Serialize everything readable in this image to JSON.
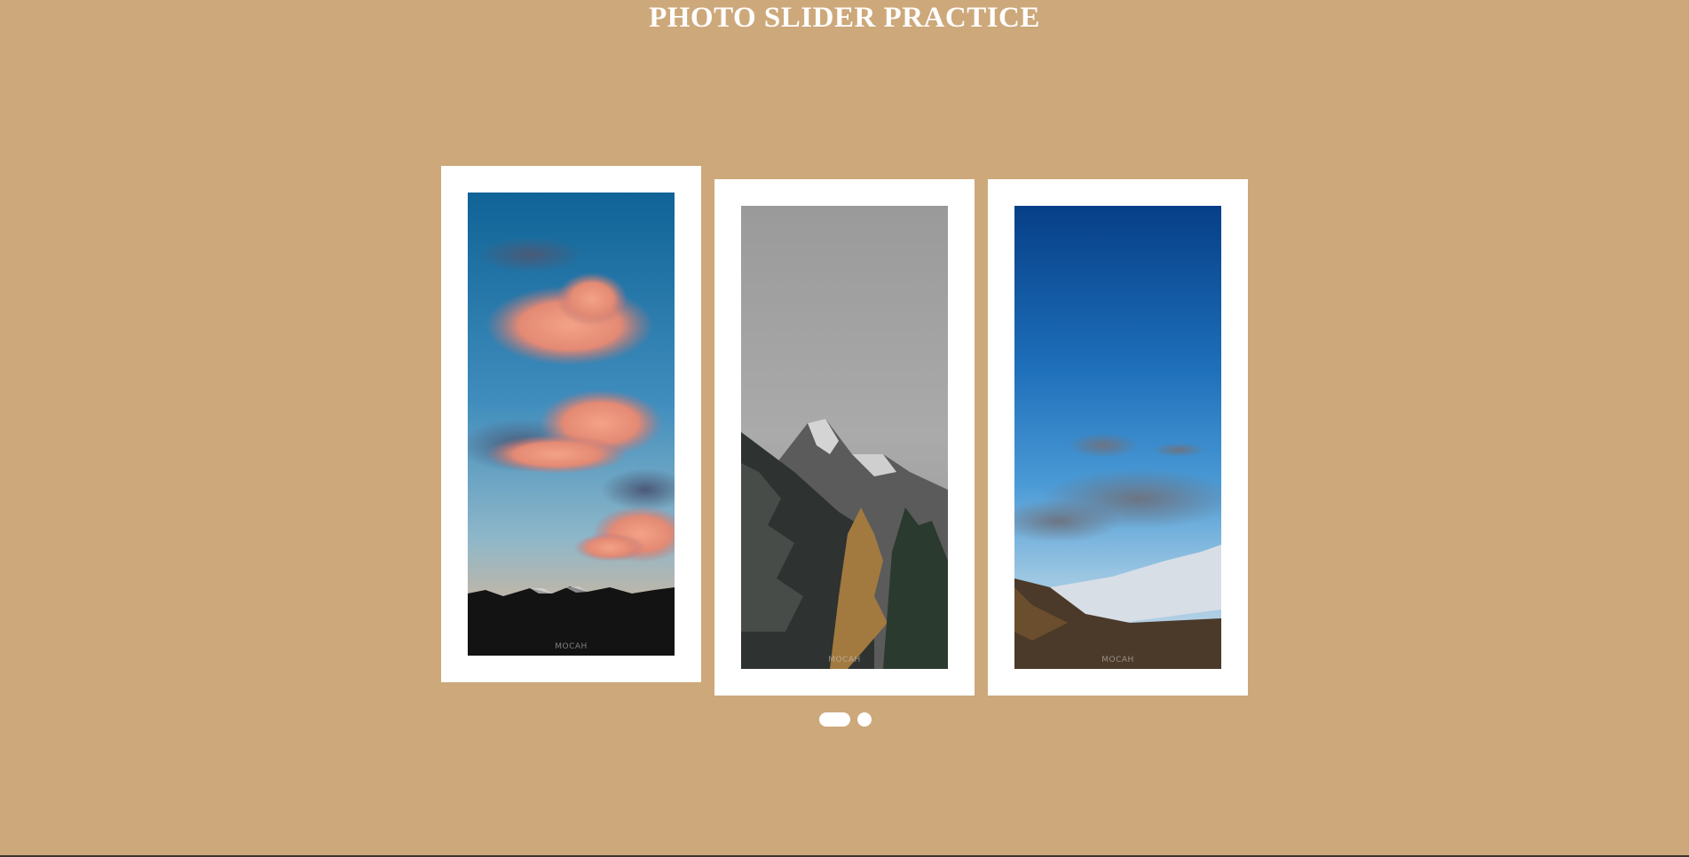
{
  "title": "PHOTO SLIDER PRACTICE",
  "slides": [
    {
      "name": "sunset-clouds-photo",
      "watermark": "MOCAH"
    },
    {
      "name": "misty-mountain-photo",
      "watermark": "MOCAH"
    },
    {
      "name": "blue-sky-valley-photo",
      "watermark": "MOCAH"
    }
  ],
  "pagination": {
    "active_index": 0,
    "count": 2
  },
  "colors": {
    "background": "#cda87a",
    "card": "#ffffff",
    "title": "#ffffff"
  }
}
